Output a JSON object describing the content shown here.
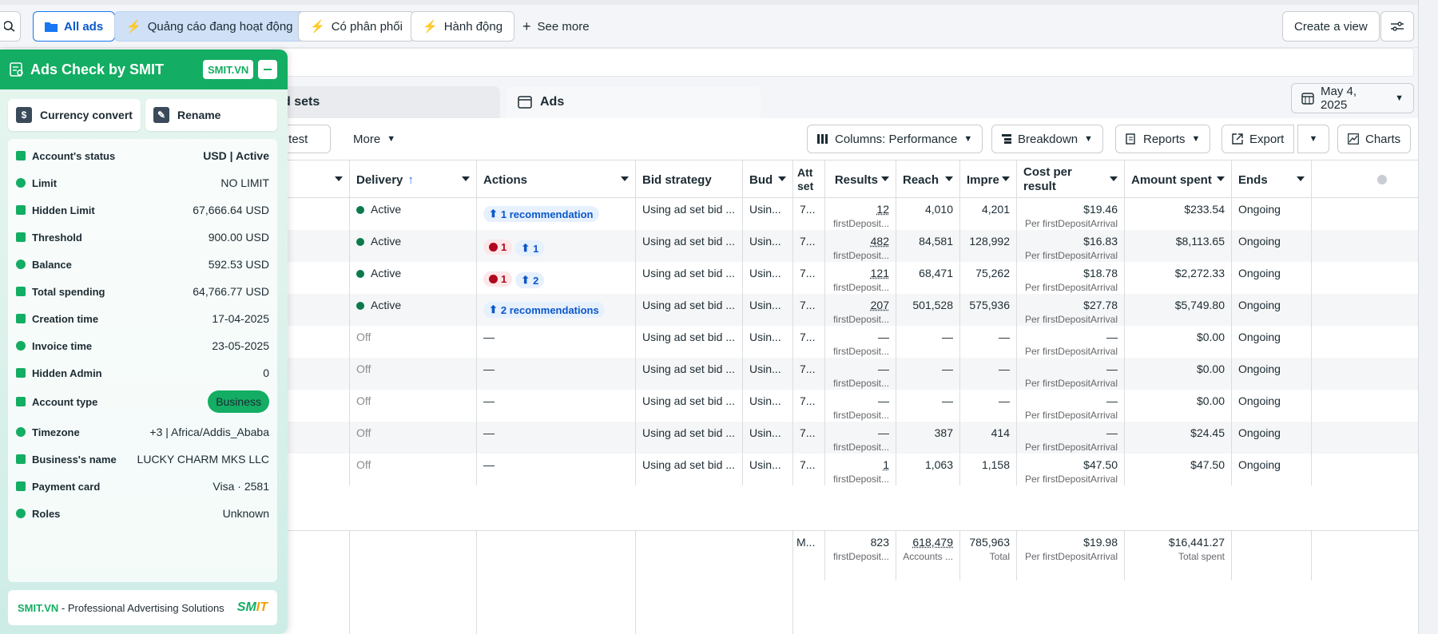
{
  "filters": {
    "all_ads": "All ads",
    "active_ads": "Quảng cáo đang hoạt động",
    "delivered": "Có phân phối",
    "actions": "Hành động",
    "see_more": "See more",
    "create_view": "Create a view"
  },
  "tabs": {
    "adsets": "d sets",
    "ads": "Ads"
  },
  "date": "May 4, 2025",
  "toolbar": {
    "ab_test": "B test",
    "more": "More",
    "columns": "Columns: Performance",
    "breakdown": "Breakdown",
    "reports": "Reports",
    "export": "Export",
    "charts": "Charts"
  },
  "columns": {
    "delivery": "Delivery",
    "actions": "Actions",
    "bid": "Bid strategy",
    "budget": "Bud",
    "attr": "Att set",
    "results": "Results",
    "reach": "Reach",
    "impr": "Impre",
    "cpr": "Cost per result",
    "spent": "Amount spent",
    "ends": "Ends"
  },
  "rows": [
    {
      "delivery": "Active",
      "active": true,
      "actions": "1 recommendation",
      "errs": "",
      "recs": "",
      "bid": "Using ad set bid ...",
      "budget": "Usin...",
      "attr": "7...",
      "results": "12",
      "results_sub": "firstDeposit...",
      "reach": "4,010",
      "impr": "4,201",
      "cpr": "$19.46",
      "cpr_sub": "Per firstDepositArrival",
      "spent": "$233.54",
      "ends": "Ongoing"
    },
    {
      "delivery": "Active",
      "active": true,
      "actions": "",
      "errs": "1",
      "recs": "1",
      "bid": "Using ad set bid ...",
      "budget": "Usin...",
      "attr": "7...",
      "results": "482",
      "results_sub": "firstDeposit...",
      "reach": "84,581",
      "impr": "128,992",
      "cpr": "$16.83",
      "cpr_sub": "Per firstDepositArrival",
      "spent": "$8,113.65",
      "ends": "Ongoing"
    },
    {
      "delivery": "Active",
      "active": true,
      "actions": "",
      "errs": "1",
      "recs": "2",
      "bid": "Using ad set bid ...",
      "budget": "Usin...",
      "attr": "7...",
      "results": "121",
      "results_sub": "firstDeposit...",
      "reach": "68,471",
      "impr": "75,262",
      "cpr": "$18.78",
      "cpr_sub": "Per firstDepositArrival",
      "spent": "$2,272.33",
      "ends": "Ongoing"
    },
    {
      "delivery": "Active",
      "active": true,
      "actions": "2 recommendations",
      "errs": "",
      "recs": "",
      "bid": "Using ad set bid ...",
      "budget": "Usin...",
      "attr": "7...",
      "results": "207",
      "results_sub": "firstDeposit...",
      "reach": "501,528",
      "impr": "575,936",
      "cpr": "$27.78",
      "cpr_sub": "Per firstDepositArrival",
      "spent": "$5,749.80",
      "ends": "Ongoing"
    },
    {
      "delivery": "Off",
      "active": false,
      "actions": "—",
      "errs": "",
      "recs": "",
      "bid": "Using ad set bid ...",
      "budget": "Usin...",
      "attr": "7...",
      "results": "—",
      "results_sub": "firstDeposit...",
      "reach": "—",
      "impr": "—",
      "cpr": "—",
      "cpr_sub": "Per firstDepositArrival",
      "spent": "$0.00",
      "ends": "Ongoing"
    },
    {
      "delivery": "Off",
      "active": false,
      "actions": "—",
      "errs": "",
      "recs": "",
      "bid": "Using ad set bid ...",
      "budget": "Usin...",
      "attr": "7...",
      "results": "—",
      "results_sub": "firstDeposit...",
      "reach": "—",
      "impr": "—",
      "cpr": "—",
      "cpr_sub": "Per firstDepositArrival",
      "spent": "$0.00",
      "ends": "Ongoing"
    },
    {
      "delivery": "Off",
      "active": false,
      "actions": "—",
      "errs": "",
      "recs": "",
      "bid": "Using ad set bid ...",
      "budget": "Usin...",
      "attr": "7...",
      "results": "—",
      "results_sub": "firstDeposit...",
      "reach": "—",
      "impr": "—",
      "cpr": "—",
      "cpr_sub": "Per firstDepositArrival",
      "spent": "$0.00",
      "ends": "Ongoing"
    },
    {
      "delivery": "Off",
      "active": false,
      "actions": "—",
      "errs": "",
      "recs": "",
      "bid": "Using ad set bid ...",
      "budget": "Usin...",
      "attr": "7...",
      "results": "—",
      "results_sub": "firstDeposit...",
      "reach": "387",
      "impr": "414",
      "cpr": "—",
      "cpr_sub": "Per firstDepositArrival",
      "spent": "$24.45",
      "ends": "Ongoing"
    },
    {
      "delivery": "Off",
      "active": false,
      "actions": "—",
      "errs": "",
      "recs": "",
      "bid": "Using ad set bid ...",
      "budget": "Usin...",
      "attr": "7...",
      "results": "1",
      "results_sub": "firstDeposit...",
      "reach": "1,063",
      "impr": "1,158",
      "cpr": "$47.50",
      "cpr_sub": "Per firstDepositArrival",
      "spent": "$47.50",
      "ends": "Ongoing"
    }
  ],
  "totals": {
    "attr": "M...",
    "results": "823",
    "results_sub": "firstDeposit...",
    "reach": "618,479",
    "reach_sub": "Accounts ...",
    "impr": "785,963",
    "impr_sub": "Total",
    "cpr": "$19.98",
    "cpr_sub": "Per firstDepositArrival",
    "spent": "$16,441.27",
    "spent_sub": "Total spent"
  },
  "panel": {
    "title": "Ads Check by SMIT",
    "badge": "SMIT.VN",
    "currency_btn": "Currency convert",
    "rename_btn": "Rename",
    "fields": [
      {
        "label": "Account's status",
        "value": "USD | Active"
      },
      {
        "label": "Limit",
        "value": "NO LIMIT"
      },
      {
        "label": "Hidden Limit",
        "value": "67,666.64 USD"
      },
      {
        "label": "Threshold",
        "value": "900.00 USD"
      },
      {
        "label": "Balance",
        "value": "592.53 USD"
      },
      {
        "label": "Total spending",
        "value": "64,766.77 USD"
      },
      {
        "label": "Creation time",
        "value": "17-04-2025"
      },
      {
        "label": "Invoice time",
        "value": "23-05-2025"
      },
      {
        "label": "Hidden Admin",
        "value": "0"
      },
      {
        "label": "Account type",
        "value": "Business"
      },
      {
        "label": "Timezone",
        "value": "+3 | Africa/Addis_Ababa"
      },
      {
        "label": "Business's name",
        "value": "LUCKY CHARM MKS LLC"
      },
      {
        "label": "Payment card",
        "value": "Visa · 2581"
      },
      {
        "label": "Roles",
        "value": "Unknown"
      }
    ],
    "footer_brand": "SMIT.VN",
    "footer_text": " - Professional Advertising Solutions",
    "logo_a": "SM",
    "logo_b": "IT"
  },
  "colors": {
    "accent": "#1877f2",
    "smit_green": "#13ad63",
    "active_dot": "#0b7a4b"
  }
}
